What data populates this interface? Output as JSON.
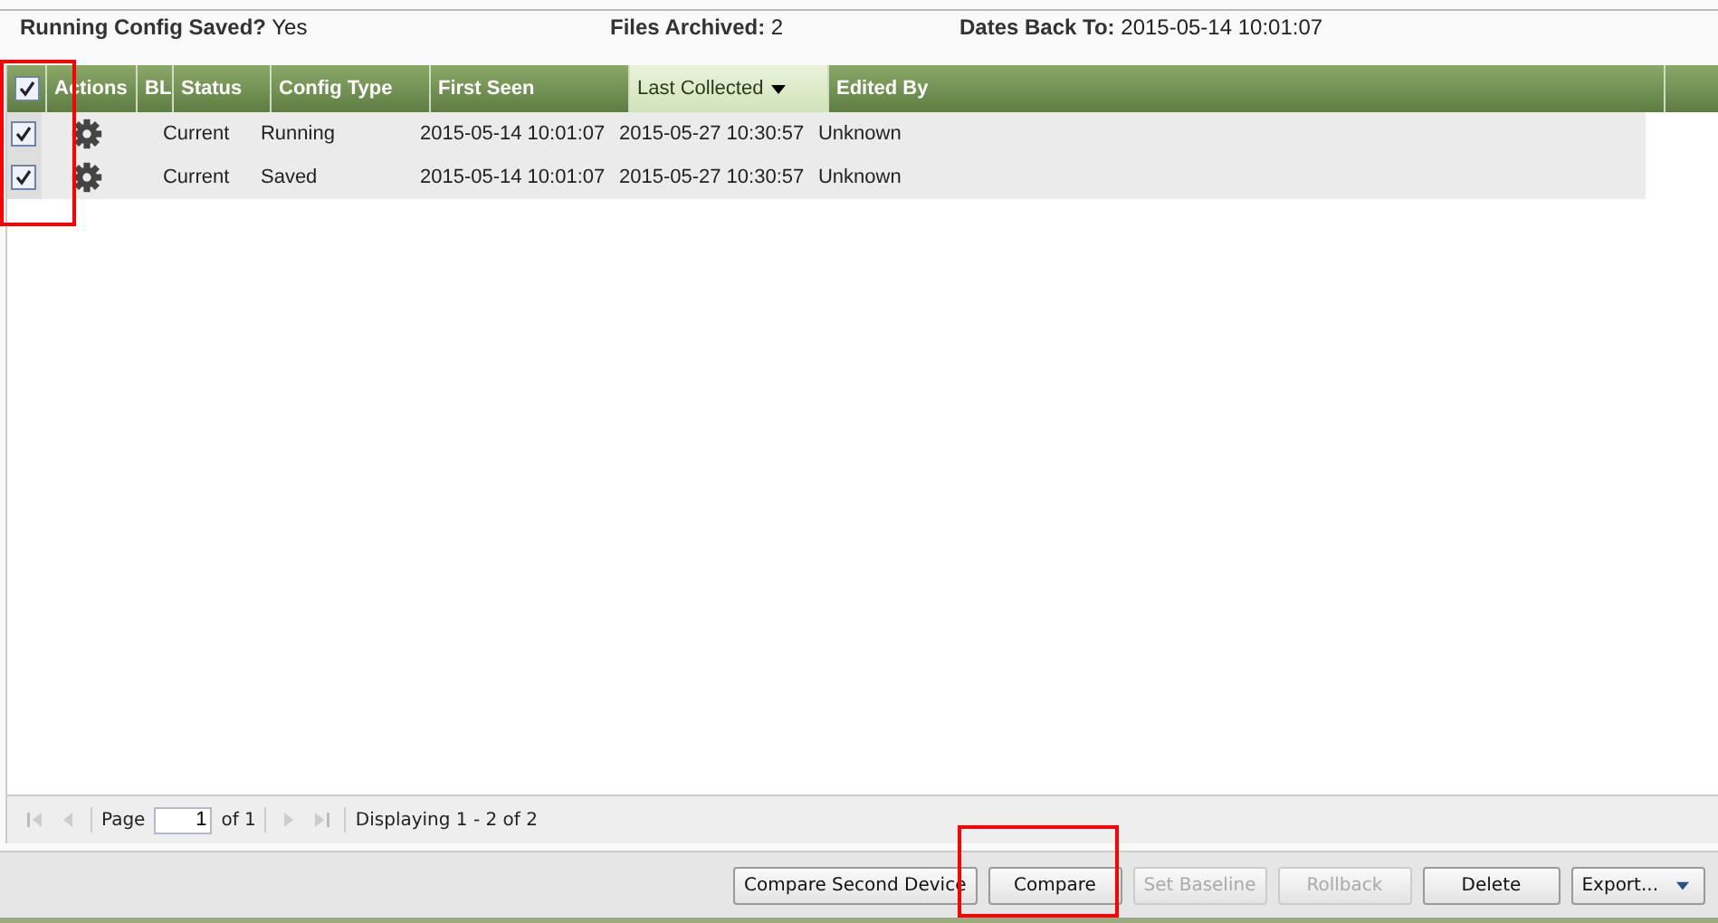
{
  "summary": [
    {
      "label": "Running Config Saved?",
      "value": "Yes"
    },
    {
      "label": "Files Archived:",
      "value": "2"
    },
    {
      "label": "Dates Back To:",
      "value": "2015-05-14 10:01:07"
    }
  ],
  "grid": {
    "select_all": {
      "checked": true
    },
    "columns": [
      {
        "label": "Actions",
        "sorted": false
      },
      {
        "label": "BL",
        "sorted": false
      },
      {
        "label": "Status",
        "sorted": false
      },
      {
        "label": "Config Type",
        "sorted": false
      },
      {
        "label": "First Seen",
        "sorted": false
      },
      {
        "label": "Last Collected",
        "sorted": true
      },
      {
        "label": "Edited By",
        "sorted": false
      }
    ],
    "rows": [
      {
        "checked": true,
        "status": "Current",
        "config_type": "Running",
        "first_seen": "2015-05-14 10:01:07",
        "last_collected": "2015-05-27 10:30:57",
        "edited_by": "Unknown"
      },
      {
        "checked": true,
        "status": "Current",
        "config_type": "Saved",
        "first_seen": "2015-05-14 10:01:07",
        "last_collected": "2015-05-27 10:30:57",
        "edited_by": "Unknown"
      }
    ]
  },
  "pager": {
    "page_label": "Page",
    "page": "1",
    "of_label": "of 1",
    "display": "Displaying 1 - 2 of 2"
  },
  "buttons": [
    {
      "label": "Compare Second Device",
      "disabled": false,
      "kind": "plain"
    },
    {
      "label": "Compare",
      "disabled": false,
      "kind": "plain"
    },
    {
      "label": "Set Baseline",
      "disabled": true,
      "kind": "plain"
    },
    {
      "label": "Rollback",
      "disabled": true,
      "kind": "plain"
    },
    {
      "label": "Delete",
      "disabled": false,
      "kind": "plain"
    },
    {
      "label": "Export...",
      "disabled": false,
      "kind": "menu"
    }
  ]
}
